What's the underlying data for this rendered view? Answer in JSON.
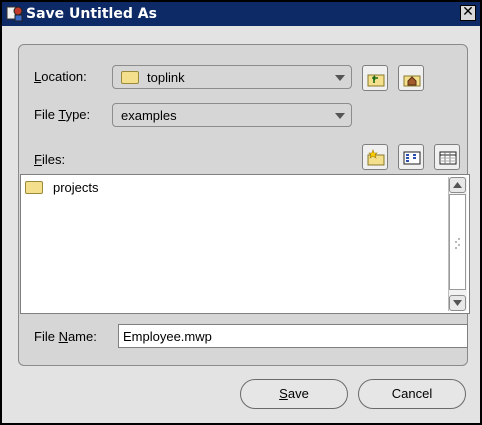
{
  "window": {
    "title": "Save Untitled As",
    "close_glyph": "✕"
  },
  "location": {
    "label_prefix": "",
    "label_mnemonic": "L",
    "label_rest": "ocation:",
    "value": "toplink"
  },
  "filetype": {
    "label_prefix": "File ",
    "label_mnemonic": "T",
    "label_rest": "ype:",
    "value": "examples"
  },
  "files": {
    "label_mnemonic": "F",
    "label_rest": "iles:",
    "items": [
      {
        "name": "projects",
        "icon": "folder-icon"
      }
    ]
  },
  "filename": {
    "label_prefix": "File ",
    "label_mnemonic": "N",
    "label_rest": "ame:",
    "value": "Employee.mwp"
  },
  "buttons": {
    "save": {
      "mnemonic": "S",
      "rest": "ave"
    },
    "cancel": {
      "label": "Cancel"
    }
  },
  "toolbar_icons": [
    "up-one-level-icon",
    "home-folder-icon",
    "new-folder-icon",
    "list-view-icon",
    "details-view-icon"
  ],
  "colors": {
    "titlebar": "#0d2a66",
    "panel": "#d6d6d6",
    "folder": "#f4df8c"
  }
}
